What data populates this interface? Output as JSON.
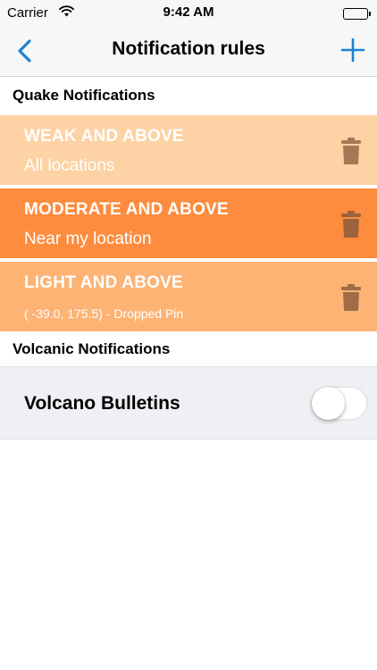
{
  "status_bar": {
    "carrier": "Carrier",
    "time": "9:42 AM"
  },
  "nav": {
    "title": "Notification rules",
    "back_icon": "chevron-left-icon",
    "add_icon": "plus-icon",
    "accent_color": "#1a82d4"
  },
  "quake_section": {
    "header": "Quake Notifications",
    "rules": [
      {
        "magnitude": "WEAK AND ABOVE",
        "location": "All locations",
        "color": "#fdd2a4",
        "icon": "trash-icon"
      },
      {
        "magnitude": "MODERATE AND ABOVE",
        "location": "Near my location",
        "color": "#fd8c3e",
        "icon": "trash-icon"
      },
      {
        "magnitude": "LIGHT AND ABOVE",
        "location": "( -39.0, 175.5) - Dropped Pin",
        "color": "#fdb374",
        "icon": "trash-icon"
      }
    ]
  },
  "volcanic_section": {
    "header": "Volcanic Notifications",
    "bulletins_label": "Volcano Bulletins",
    "bulletins_enabled": false
  }
}
